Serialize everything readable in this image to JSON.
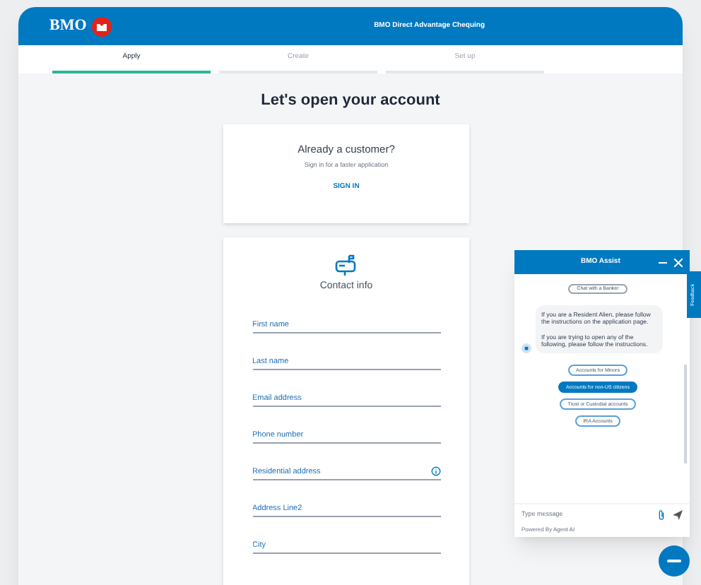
{
  "header": {
    "logo": "BMO",
    "title": "BMO Direct Advantage Chequing"
  },
  "tabs": [
    {
      "label": "Apply",
      "selected": true
    },
    {
      "label": "Create",
      "selected": false
    },
    {
      "label": "Set up",
      "selected": false
    }
  ],
  "heading": "Let's open your account",
  "signin_card": {
    "title": "Already a customer?",
    "subtitle": "Sign in for a faster application",
    "link": "SIGN IN"
  },
  "contact_card": {
    "title": "Contact info",
    "fields": [
      {
        "placeholder": "First name",
        "info": false
      },
      {
        "placeholder": "Last name",
        "info": false
      },
      {
        "placeholder": "Email address",
        "info": false
      },
      {
        "placeholder": "Phone number",
        "info": false
      },
      {
        "placeholder": "Residential address",
        "info": true
      },
      {
        "placeholder": "Address Line2",
        "info": false
      },
      {
        "placeholder": "City",
        "info": false
      }
    ]
  },
  "chat": {
    "title": "BMO Assist",
    "top_option": "Chat with a Banker",
    "message": [
      "If you are a Resident Alien, please follow the instructions on the application page.",
      "If you are trying to open any of the following, please follow the instructions."
    ],
    "options": [
      {
        "label": "Accounts for Minors",
        "selected": false
      },
      {
        "label": "Accounts for non-US citizens",
        "selected": true
      },
      {
        "label": "Trust or Custodial accounts",
        "selected": false
      },
      {
        "label": "IRA Accounts",
        "selected": false
      }
    ],
    "input": {
      "placeholder": "Type message"
    },
    "footer": "Powered By Agent AI"
  },
  "feedback_tab": "Feedback"
}
